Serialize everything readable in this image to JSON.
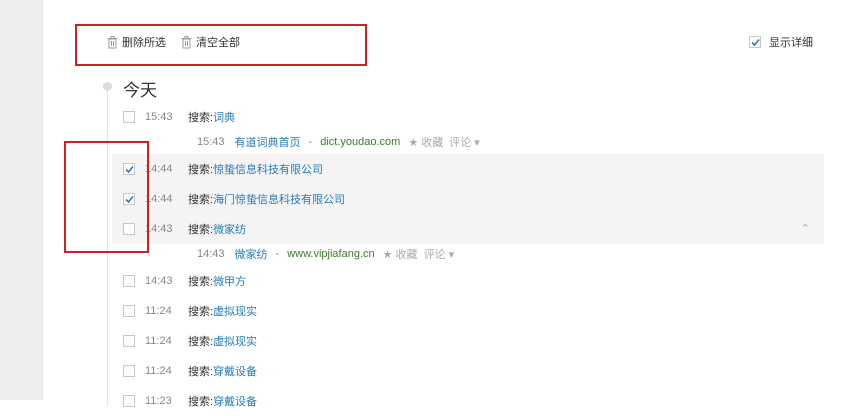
{
  "toolbar": {
    "delete_selected": "删除所选",
    "clear_all": "清空全部",
    "show_detail": "显示详细",
    "show_detail_checked": true
  },
  "day": {
    "title": "今天"
  },
  "rows": [
    {
      "time": "15:43",
      "prefix": "搜索:",
      "keyword": "词典",
      "checked": false
    },
    {
      "time": "14:44",
      "prefix": "搜索:",
      "keyword": "惊蛰信息科技有限公司",
      "checked": true
    },
    {
      "time": "14:44",
      "prefix": "搜索:",
      "keyword": "海门惊蛰信息科技有限公司",
      "checked": true
    },
    {
      "time": "14:43",
      "prefix": "搜索:",
      "keyword": "微家纺",
      "checked": false
    },
    {
      "time": "14:43",
      "prefix": "搜索:",
      "keyword": "微甲方",
      "checked": false
    },
    {
      "time": "11:24",
      "prefix": "搜索:",
      "keyword": "虚拟现实",
      "checked": false
    },
    {
      "time": "11:24",
      "prefix": "搜索:",
      "keyword": "虚拟现实",
      "checked": false
    },
    {
      "time": "11:24",
      "prefix": "搜索:",
      "keyword": "穿戴设备",
      "checked": false
    },
    {
      "time": "11:23",
      "prefix": "搜索:",
      "keyword": "穿戴设备",
      "checked": false
    }
  ],
  "subs": [
    {
      "time": "15:43",
      "site": "有道词典首页",
      "dash": "-",
      "domain": "dict.youdao.com",
      "fav": "★ 收藏",
      "comment": "评论 ▾"
    },
    {
      "time": "14:43",
      "site": "微家纺",
      "dash": "-",
      "domain": "www.vipjiafang.cn",
      "fav": "★ 收藏",
      "comment": "评论 ▾"
    }
  ],
  "icons": {
    "trash": "trash-icon",
    "check": "check-icon",
    "collapse": "chevron-up-icon"
  },
  "colors": {
    "annotation": "#d31f1f",
    "link": "#2a7bb5",
    "domain": "#3a7d2a",
    "check": "#2a7bb5"
  }
}
